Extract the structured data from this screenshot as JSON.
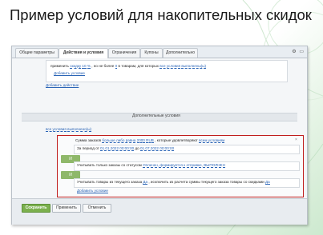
{
  "slide": {
    "title": "Пример условий для накопительных скидок"
  },
  "tabs": [
    {
      "label": "Общие параметры"
    },
    {
      "label": "Действия и условия"
    },
    {
      "label": "Ограничения"
    },
    {
      "label": "Купоны"
    },
    {
      "label": "Дополнительно"
    }
  ],
  "action": {
    "w1": "применить",
    "w2": "скидку",
    "w3": "10",
    "w4": "%",
    "w5": ", но не более",
    "w6": "0",
    "w7": "в товарам, для которых",
    "w8": "все условия",
    "w9": "выполнены(ы)",
    "add_condition": "Добавить условие",
    "add_action": "Добавить действие"
  },
  "extra": {
    "section_title": "Дополнительные условия",
    "w1": "все условия",
    "w2": "выполнено(ы)",
    "sum_label": "Сумма заказов",
    "sum_op": "больше либо равна",
    "sum_value": "2000",
    "currency": "RUB",
    "sum_tail": ", которые удовлетворяют",
    "sum_all": "всем условиям",
    "period_label": "За период",
    "period_from": "от",
    "date_from": "01.01.2022 00:00:00",
    "period_to": "до",
    "date_to": "01.07.2022 00:00:00",
    "and1": "И",
    "status_label": "Учитывать только заказы со статусом",
    "status_value": "Оплачен, формируется к отправке, ВЫПОЛНЕН",
    "and2": "И",
    "goods_label": "Учитывать товары из текущего заказа",
    "goods_yes": "Да",
    "goods_tail": ", исключить из расчета суммы текущего заказа товары со скидками",
    "goods_yes2": "Да",
    "add_condition_inner": "Добавить условие",
    "add_condition": "Добавить условие"
  },
  "buttons": {
    "save": "Сохранить",
    "apply": "Применить",
    "cancel": "Отменить"
  }
}
